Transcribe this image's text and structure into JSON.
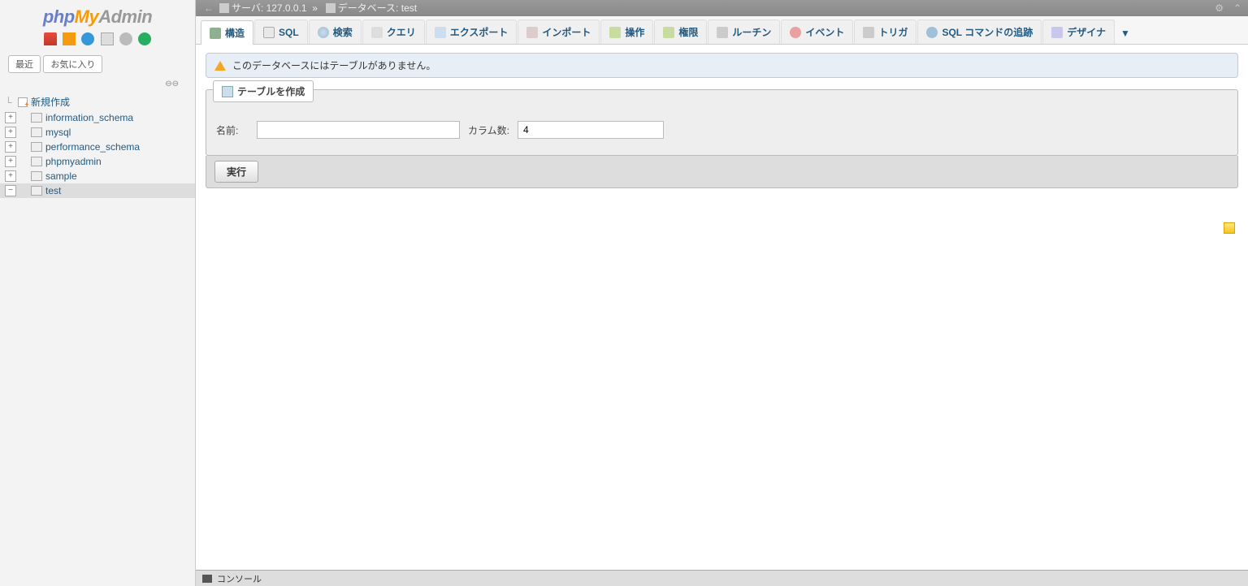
{
  "logo": {
    "php": "php",
    "my": "My",
    "admin": "Admin"
  },
  "sidebar": {
    "recent": "最近",
    "favorites": "お気に入り",
    "new": "新規作成",
    "databases": [
      {
        "name": "information_schema",
        "selected": false
      },
      {
        "name": "mysql",
        "selected": false
      },
      {
        "name": "performance_schema",
        "selected": false
      },
      {
        "name": "phpmyadmin",
        "selected": false
      },
      {
        "name": "sample",
        "selected": false
      },
      {
        "name": "test",
        "selected": true
      }
    ]
  },
  "breadcrumb": {
    "server_label": "サーバ:",
    "server_value": "127.0.0.1",
    "sep": "»",
    "db_label": "データベース:",
    "db_value": "test"
  },
  "tabs": [
    {
      "id": "structure",
      "label": "構造",
      "active": true
    },
    {
      "id": "sql",
      "label": "SQL",
      "active": false
    },
    {
      "id": "search",
      "label": "検索",
      "active": false
    },
    {
      "id": "query",
      "label": "クエリ",
      "active": false
    },
    {
      "id": "export",
      "label": "エクスポート",
      "active": false
    },
    {
      "id": "import",
      "label": "インポート",
      "active": false
    },
    {
      "id": "operations",
      "label": "操作",
      "active": false
    },
    {
      "id": "privileges",
      "label": "権限",
      "active": false
    },
    {
      "id": "routines",
      "label": "ルーチン",
      "active": false
    },
    {
      "id": "events",
      "label": "イベント",
      "active": false
    },
    {
      "id": "triggers",
      "label": "トリガ",
      "active": false
    },
    {
      "id": "tracking",
      "label": "SQL コマンドの追跡",
      "active": false
    },
    {
      "id": "designer",
      "label": "デザイナ",
      "active": false
    }
  ],
  "notice": "このデータベースにはテーブルがありません。",
  "create": {
    "legend": "テーブルを作成",
    "name_label": "名前:",
    "name_value": "",
    "columns_label": "カラム数:",
    "columns_value": "4",
    "go": "実行"
  },
  "console": "コンソール"
}
